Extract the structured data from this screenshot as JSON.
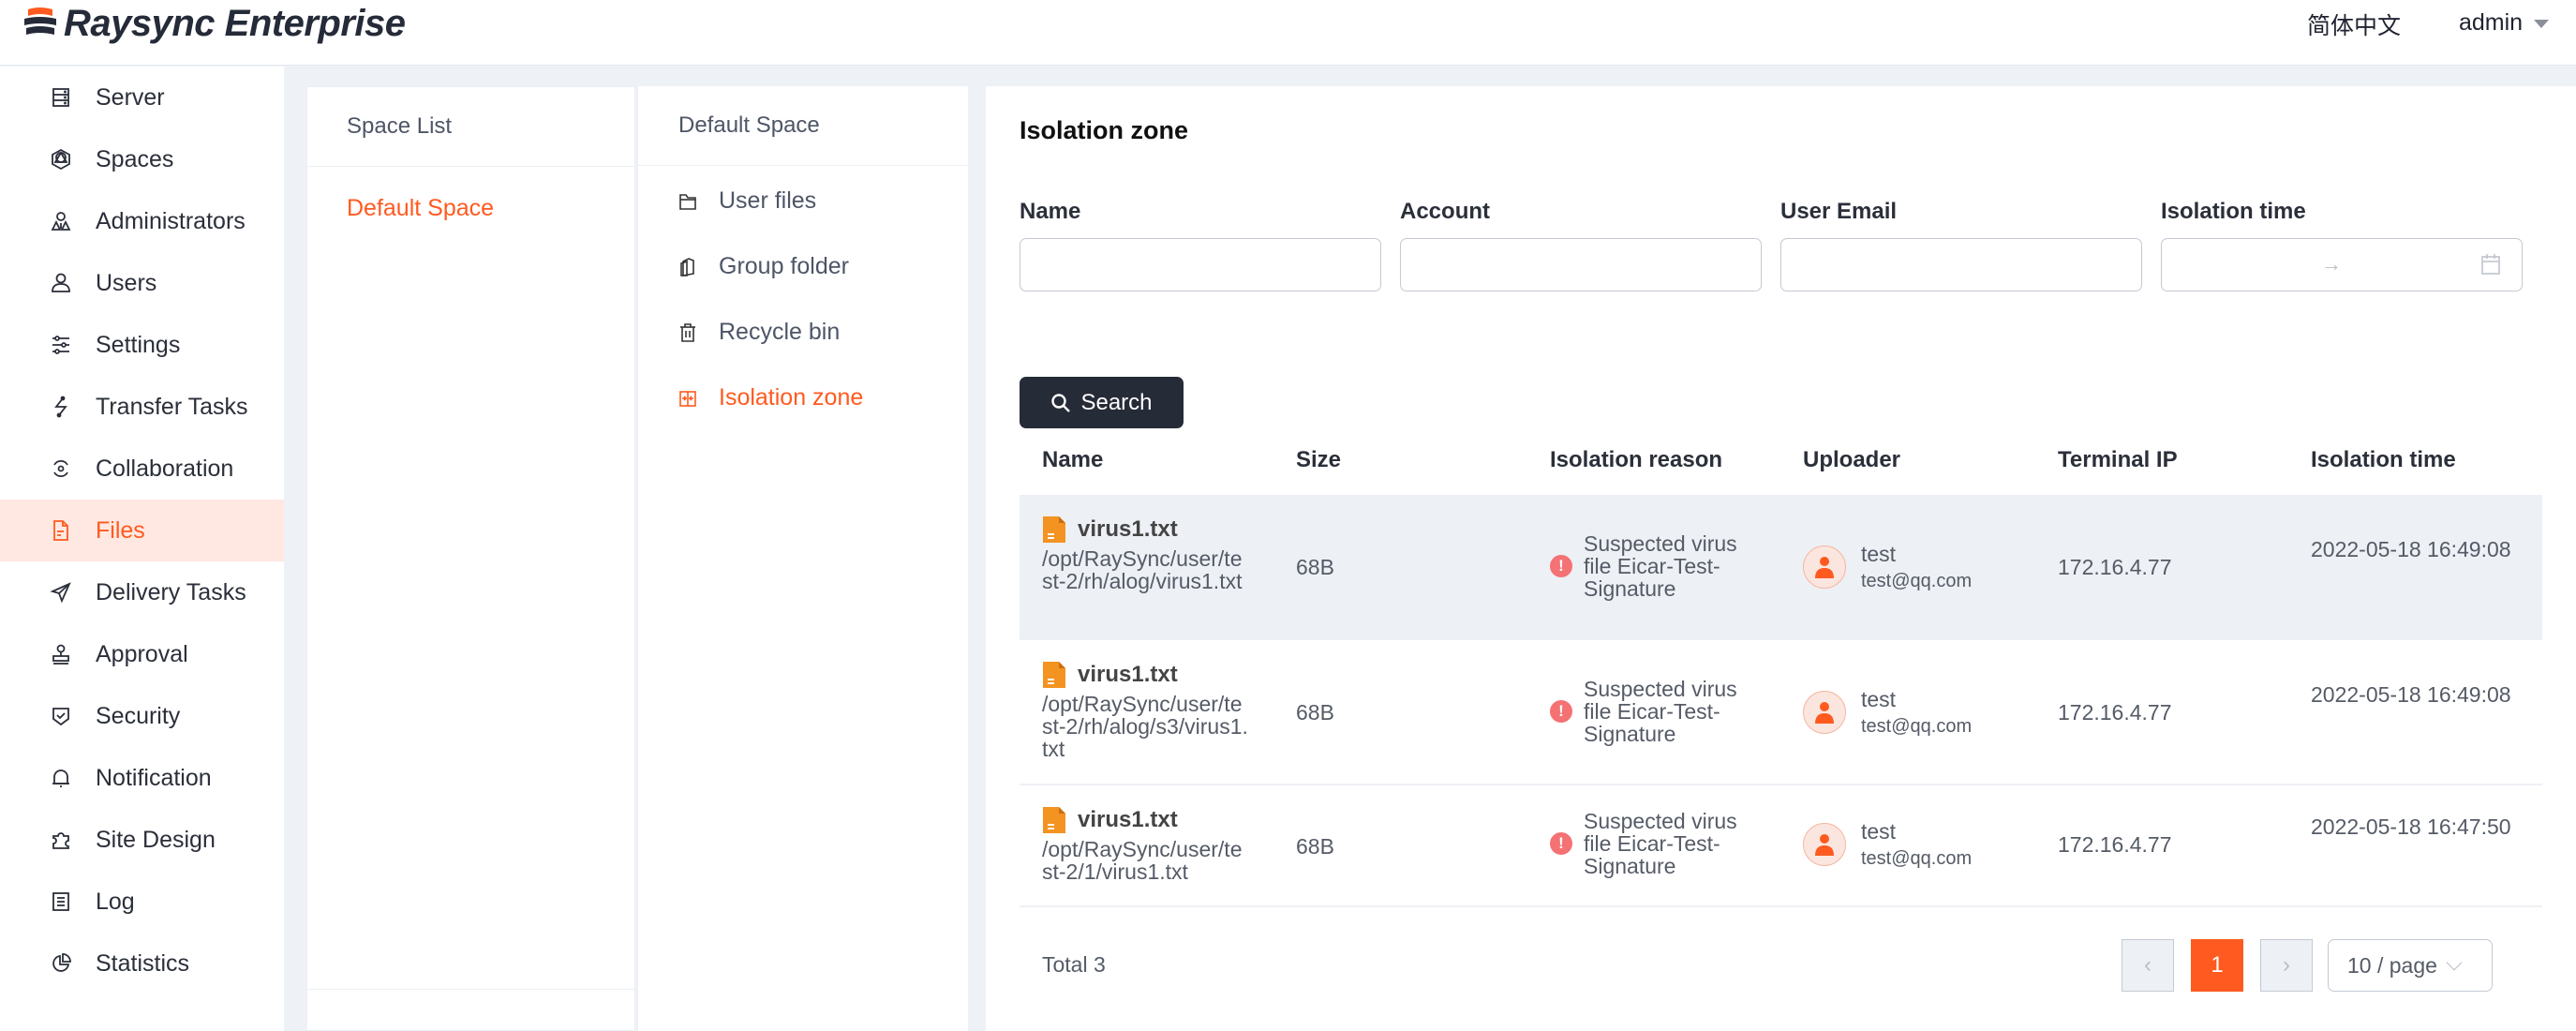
{
  "header": {
    "app_title": "Raysync Enterprise",
    "language": "简体中文",
    "user": "admin"
  },
  "sidebar": {
    "items": [
      {
        "label": "Server",
        "icon": "server-icon"
      },
      {
        "label": "Spaces",
        "icon": "spaces-icon"
      },
      {
        "label": "Administrators",
        "icon": "administrators-icon"
      },
      {
        "label": "Users",
        "icon": "user-icon"
      },
      {
        "label": "Settings",
        "icon": "sliders-icon"
      },
      {
        "label": "Transfer Tasks",
        "icon": "transfer-icon"
      },
      {
        "label": "Collaboration",
        "icon": "collaboration-icon"
      },
      {
        "label": "Files",
        "icon": "file-icon",
        "active": true
      },
      {
        "label": "Delivery Tasks",
        "icon": "send-icon"
      },
      {
        "label": "Approval",
        "icon": "stamp-icon"
      },
      {
        "label": "Security",
        "icon": "shield-check-icon"
      },
      {
        "label": "Notification",
        "icon": "bell-icon"
      },
      {
        "label": "Site Design",
        "icon": "puzzle-icon"
      },
      {
        "label": "Log",
        "icon": "log-icon"
      },
      {
        "label": "Statistics",
        "icon": "pie-chart-icon"
      }
    ]
  },
  "space_list": {
    "title": "Space List",
    "items": [
      {
        "label": "Default Space",
        "active": true
      }
    ]
  },
  "default_space": {
    "title": "Default Space",
    "items": [
      {
        "label": "User files",
        "icon": "folder-icon"
      },
      {
        "label": "Group folder",
        "icon": "group-folder-icon"
      },
      {
        "label": "Recycle bin",
        "icon": "trash-icon"
      },
      {
        "label": "Isolation zone",
        "icon": "isolation-icon",
        "active": true
      }
    ]
  },
  "main": {
    "title": "Isolation zone",
    "filters": {
      "name": {
        "label": "Name",
        "value": "",
        "placeholder": ""
      },
      "account": {
        "label": "Account",
        "value": "",
        "placeholder": ""
      },
      "email": {
        "label": "User Email",
        "value": "",
        "placeholder": ""
      },
      "time": {
        "label": "Isolation time",
        "separator": "→"
      }
    },
    "search_label": "Search",
    "table": {
      "columns": [
        "Name",
        "Size",
        "Isolation reason",
        "Uploader",
        "Terminal IP",
        "Isolation time"
      ],
      "rows": [
        {
          "name": "virus1.txt",
          "path": "/opt/RaySync/user/test-2/rh/alog/virus1.txt",
          "size": "68B",
          "reason": "Suspected virus file Eicar-Test-Signature",
          "uploader": "test",
          "email": "test@qq.com",
          "ip": "172.16.4.77",
          "time": "2022-05-18 16:49:08"
        },
        {
          "name": "virus1.txt",
          "path": "/opt/RaySync/user/test-2/rh/alog/s3/virus1.txt",
          "size": "68B",
          "reason": "Suspected virus file Eicar-Test-Signature",
          "uploader": "test",
          "email": "test@qq.com",
          "ip": "172.16.4.77",
          "time": "2022-05-18 16:49:08"
        },
        {
          "name": "virus1.txt",
          "path": "/opt/RaySync/user/test-2/1/virus1.txt",
          "size": "68B",
          "reason": "Suspected virus file Eicar-Test-Signature",
          "uploader": "test",
          "email": "test@qq.com",
          "ip": "172.16.4.77",
          "time": "2022-05-18 16:47:50"
        }
      ]
    },
    "pagination": {
      "total_label": "Total 3",
      "prev": "‹",
      "current_page": "1",
      "next": "›",
      "page_size": "10 / page"
    }
  },
  "colors": {
    "accent": "#ff5a1f",
    "accent_bg": "#ffe8e1",
    "dark_button": "#262b38",
    "warning": "#f47174",
    "file_icon": "#f39322"
  }
}
